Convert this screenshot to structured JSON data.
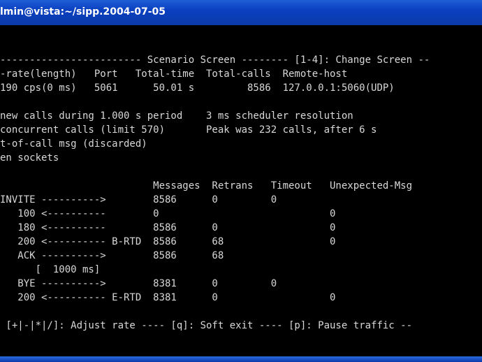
{
  "window": {
    "title": "lmin@vista:~/sipp.2004-07-05"
  },
  "screen_lines": [
    "------------------------ Scenario Screen -------- [1-4]: Change Screen --",
    "-rate(length)   Port   Total-time  Total-calls  Remote-host",
    "190 cps(0 ms)   5061      50.01 s         8586  127.0.0.1:5060(UDP)",
    "",
    "new calls during 1.000 s period    3 ms scheduler resolution",
    "concurrent calls (limit 570)       Peak was 232 calls, after 6 s",
    "t-of-call msg (discarded)",
    "en sockets",
    "",
    "                          Messages  Retrans   Timeout   Unexpected-Msg",
    "INVITE ---------->        8586      0         0",
    "   100 <----------        0                             0",
    "   180 <----------        8586      0                   0",
    "   200 <---------- B-RTD  8586      68                  0",
    "   ACK ---------->        8586      68",
    "      [  1000 ms]",
    "   BYE ---------->        8381      0         0",
    "   200 <---------- E-RTD  8381      0                   0",
    "",
    " [+|-|*|/]: Adjust rate ---- [q]: Soft exit ---- [p]: Pause traffic --"
  ]
}
